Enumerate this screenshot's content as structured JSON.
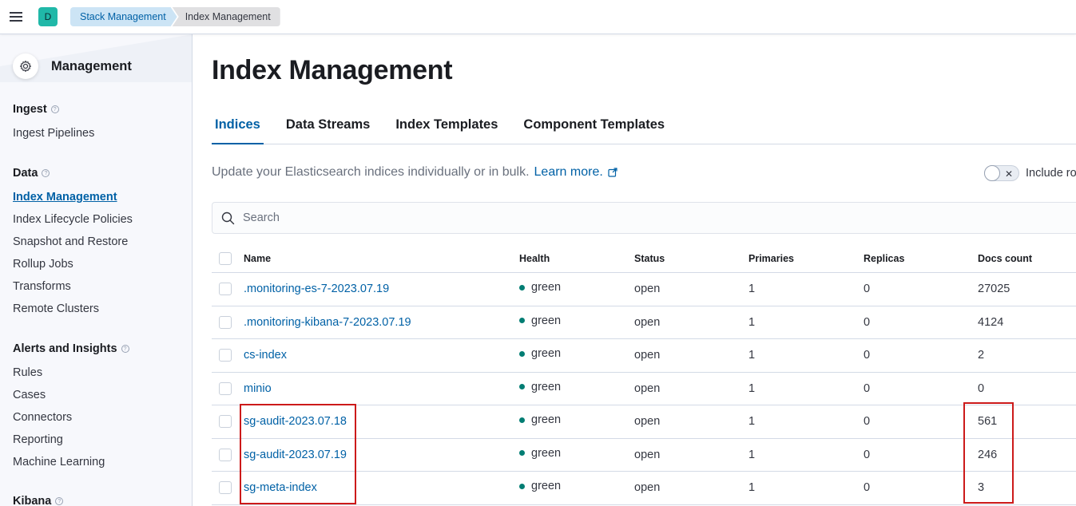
{
  "header": {
    "space_initial": "D",
    "breadcrumbs": [
      "Stack Management",
      "Index Management"
    ]
  },
  "sidebar": {
    "title": "Management",
    "groups": [
      {
        "title": "Ingest",
        "items": [
          "Ingest Pipelines"
        ]
      },
      {
        "title": "Data",
        "items": [
          "Index Management",
          "Index Lifecycle Policies",
          "Snapshot and Restore",
          "Rollup Jobs",
          "Transforms",
          "Remote Clusters"
        ]
      },
      {
        "title": "Alerts and Insights",
        "items": [
          "Rules",
          "Cases",
          "Connectors",
          "Reporting",
          "Machine Learning"
        ]
      },
      {
        "title": "Kibana",
        "items": []
      }
    ],
    "active_item": "Index Management"
  },
  "main": {
    "title": "Index Management",
    "tabs": [
      "Indices",
      "Data Streams",
      "Index Templates",
      "Component Templates"
    ],
    "selected_tab": "Indices",
    "description": "Update your Elasticsearch indices individually or in bulk.",
    "learn_more": "Learn more.",
    "toggle_label": "Include ro",
    "search_placeholder": "Search"
  },
  "table": {
    "columns": [
      "Name",
      "Health",
      "Status",
      "Primaries",
      "Replicas",
      "Docs count"
    ],
    "rows": [
      {
        "name": ".monitoring-es-7-2023.07.19",
        "health": "green",
        "status": "open",
        "primaries": "1",
        "replicas": "0",
        "docs": "27025"
      },
      {
        "name": ".monitoring-kibana-7-2023.07.19",
        "health": "green",
        "status": "open",
        "primaries": "1",
        "replicas": "0",
        "docs": "4124"
      },
      {
        "name": "cs-index",
        "health": "green",
        "status": "open",
        "primaries": "1",
        "replicas": "0",
        "docs": "2"
      },
      {
        "name": "minio",
        "health": "green",
        "status": "open",
        "primaries": "1",
        "replicas": "0",
        "docs": "0"
      },
      {
        "name": "sg-audit-2023.07.18",
        "health": "green",
        "status": "open",
        "primaries": "1",
        "replicas": "0",
        "docs": "561"
      },
      {
        "name": "sg-audit-2023.07.19",
        "health": "green",
        "status": "open",
        "primaries": "1",
        "replicas": "0",
        "docs": "246"
      },
      {
        "name": "sg-meta-index",
        "health": "green",
        "status": "open",
        "primaries": "1",
        "replicas": "0",
        "docs": "3"
      }
    ]
  },
  "colors": {
    "link": "#0061a6",
    "health_green": "#017d73",
    "highlight": "#cc1a1a"
  }
}
